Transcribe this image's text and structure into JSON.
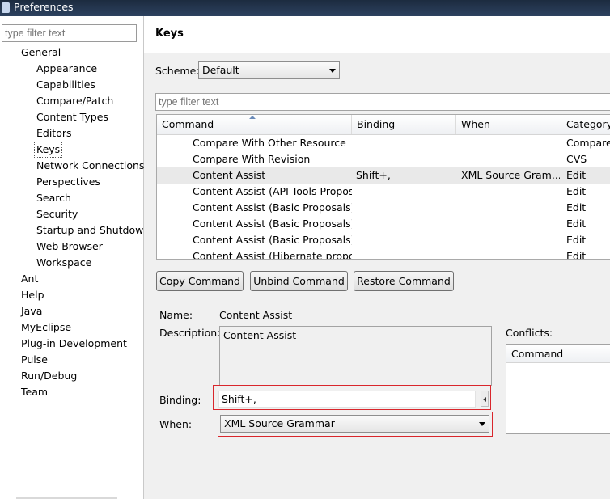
{
  "window": {
    "title": "Preferences"
  },
  "sidebar": {
    "filter_placeholder": "type filter text",
    "items": [
      {
        "label": "General"
      },
      {
        "label": "Appearance"
      },
      {
        "label": "Capabilities"
      },
      {
        "label": "Compare/Patch"
      },
      {
        "label": "Content Types"
      },
      {
        "label": "Editors"
      },
      {
        "label": "Keys",
        "selected": true
      },
      {
        "label": "Network Connections"
      },
      {
        "label": "Perspectives"
      },
      {
        "label": "Search"
      },
      {
        "label": "Security"
      },
      {
        "label": "Startup and Shutdown"
      },
      {
        "label": "Web Browser"
      },
      {
        "label": "Workspace"
      },
      {
        "label": "Ant"
      },
      {
        "label": "Help"
      },
      {
        "label": "Java"
      },
      {
        "label": "MyEclipse"
      },
      {
        "label": "Plug-in Development"
      },
      {
        "label": "Pulse"
      },
      {
        "label": "Run/Debug"
      },
      {
        "label": "Team"
      }
    ]
  },
  "page": {
    "title": "Keys",
    "scheme_label": "Scheme:",
    "scheme_value": "Default",
    "filter_placeholder": "type filter text"
  },
  "table": {
    "headers": [
      "Command",
      "Binding",
      "When",
      "Category"
    ],
    "rows": [
      {
        "command": "Compare With Other Resource",
        "binding": "",
        "when": "",
        "category": "Compare"
      },
      {
        "command": "Compare With Revision",
        "binding": "",
        "when": "",
        "category": "CVS"
      },
      {
        "command": "Content Assist",
        "binding": "Shift+,",
        "when": "XML Source Gram...",
        "category": "Edit",
        "selected": true
      },
      {
        "command": "Content Assist (API Tools Proposals)",
        "binding": "",
        "when": "",
        "category": "Edit"
      },
      {
        "command": "Content Assist (Basic Proposals)",
        "binding": "",
        "when": "",
        "category": "Edit"
      },
      {
        "command": "Content Assist (Basic Proposals)",
        "binding": "",
        "when": "",
        "category": "Edit"
      },
      {
        "command": "Content Assist (Basic Proposals)",
        "binding": "",
        "when": "",
        "category": "Edit"
      },
      {
        "command": "Content Assist (Hibernate proposals)",
        "binding": "",
        "when": "",
        "category": "Edit"
      }
    ]
  },
  "buttons": {
    "copy": "Copy Command",
    "unbind": "Unbind Command",
    "restore": "Restore Command"
  },
  "details": {
    "name_label": "Name:",
    "name_value": "Content Assist",
    "description_label": "Description:",
    "description_value": "Content Assist",
    "conflicts_label": "Conflicts:",
    "conflicts_header": "Command",
    "binding_label": "Binding:",
    "binding_value": "Shift+,",
    "when_label": "When:",
    "when_value": "XML Source Grammar"
  },
  "colors": {
    "highlight_border": "#d9262c",
    "titlebar": "#1c2b3f"
  }
}
